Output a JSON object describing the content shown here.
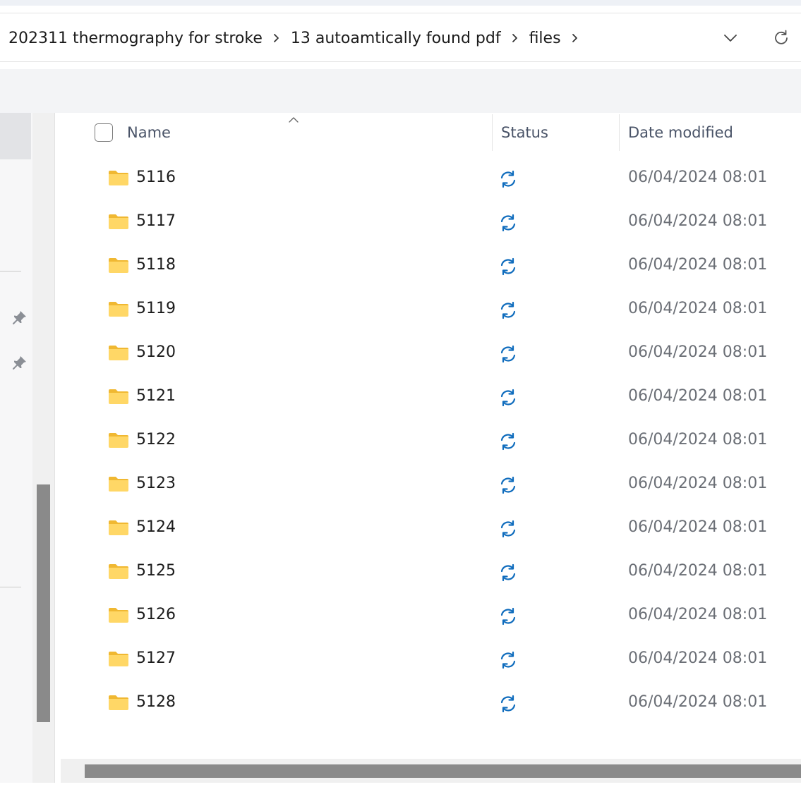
{
  "breadcrumb": {
    "items": [
      "202311 thermography for stroke",
      "13 autoamtically found pdf",
      "files"
    ]
  },
  "icons": {
    "dropdown": "chevron-down-icon",
    "refresh": "refresh-icon",
    "pin": "pin-icon",
    "folder": "folder-icon",
    "status": "sync-pending-icon"
  },
  "columns": {
    "name": "Name",
    "status": "Status",
    "date_modified": "Date modified"
  },
  "rows": [
    {
      "name": "5116",
      "date": "06/04/2024 08:01"
    },
    {
      "name": "5117",
      "date": "06/04/2024 08:01"
    },
    {
      "name": "5118",
      "date": "06/04/2024 08:01"
    },
    {
      "name": "5119",
      "date": "06/04/2024 08:01"
    },
    {
      "name": "5120",
      "date": "06/04/2024 08:01"
    },
    {
      "name": "5121",
      "date": "06/04/2024 08:01"
    },
    {
      "name": "5122",
      "date": "06/04/2024 08:01"
    },
    {
      "name": "5123",
      "date": "06/04/2024 08:01"
    },
    {
      "name": "5124",
      "date": "06/04/2024 08:01"
    },
    {
      "name": "5125",
      "date": "06/04/2024 08:01"
    },
    {
      "name": "5126",
      "date": "06/04/2024 08:01"
    },
    {
      "name": "5127",
      "date": "06/04/2024 08:01"
    },
    {
      "name": "5128",
      "date": "06/04/2024 08:01"
    }
  ],
  "colors": {
    "status_icon": "#0f6cbd",
    "folder_body": "#ffd766",
    "folder_tab": "#f0b832",
    "date_text": "#6b6f76",
    "scroll_thumb": "#8a8a8a"
  }
}
